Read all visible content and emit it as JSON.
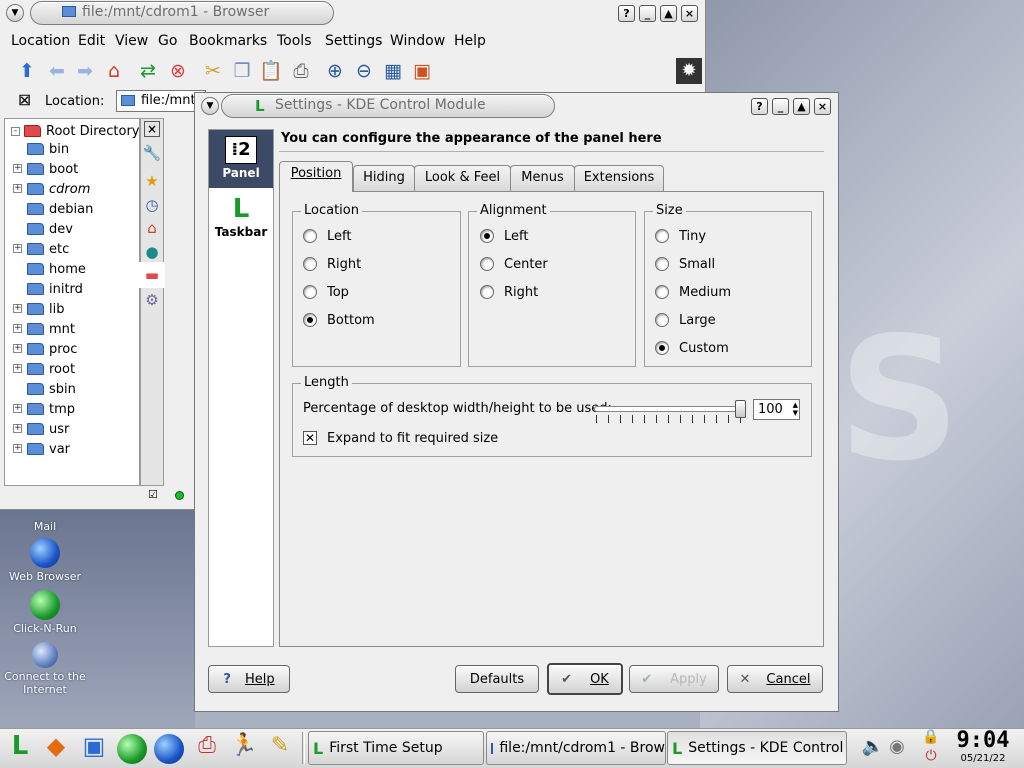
{
  "browser": {
    "title": "file:/mnt/cdrom1 - Browser",
    "menus": [
      "Location",
      "Edit",
      "View",
      "Go",
      "Bookmarks",
      "Tools",
      "Settings",
      "Window",
      "Help"
    ],
    "location_label": "Location:",
    "location_value": "file:/mnt/",
    "tree_root": "Root Directory",
    "tree_items": [
      "bin",
      "boot",
      "cdrom",
      "debian",
      "dev",
      "etc",
      "home",
      "initrd",
      "lib",
      "mnt",
      "proc",
      "root",
      "sbin",
      "tmp",
      "usr",
      "var"
    ]
  },
  "desktop_icons": [
    {
      "label": "Mail"
    },
    {
      "label": "Web Browser"
    },
    {
      "label": "Click-N-Run"
    },
    {
      "label": "Connect to the Internet"
    }
  ],
  "settings": {
    "title": "Settings - KDE Control Module",
    "sidebar": [
      {
        "label": "Panel"
      },
      {
        "label": "Taskbar"
      }
    ],
    "heading": "You can configure the appearance of the panel here",
    "tabs": [
      "Position",
      "Hiding",
      "Look & Feel",
      "Menus",
      "Extensions"
    ],
    "location": {
      "title": "Location",
      "options": [
        "Left",
        "Right",
        "Top",
        "Bottom"
      ],
      "selected": "Bottom"
    },
    "alignment": {
      "title": "Alignment",
      "options": [
        "Left",
        "Center",
        "Right"
      ],
      "selected": "Left"
    },
    "size": {
      "title": "Size",
      "options": [
        "Tiny",
        "Small",
        "Medium",
        "Large",
        "Custom"
      ],
      "selected": "Custom"
    },
    "length": {
      "title": "Length",
      "label": "Percentage of desktop width/height to be used:",
      "value": "100",
      "expand_label": "Expand to fit required size",
      "expand_checked": true
    },
    "buttons": {
      "help": "Help",
      "defaults": "Defaults",
      "ok": "OK",
      "apply": "Apply",
      "cancel": "Cancel"
    }
  },
  "taskbar": {
    "tasks": [
      "First Time Setup",
      "file:/mnt/cdrom1 - Brow",
      "Settings - KDE Control"
    ],
    "clock_time": "9:04",
    "clock_date": "05/21/22"
  },
  "colors": {
    "accent": "#2c5aa0",
    "window_bg": "#efefef",
    "green_logo": "#1a9a2a"
  }
}
